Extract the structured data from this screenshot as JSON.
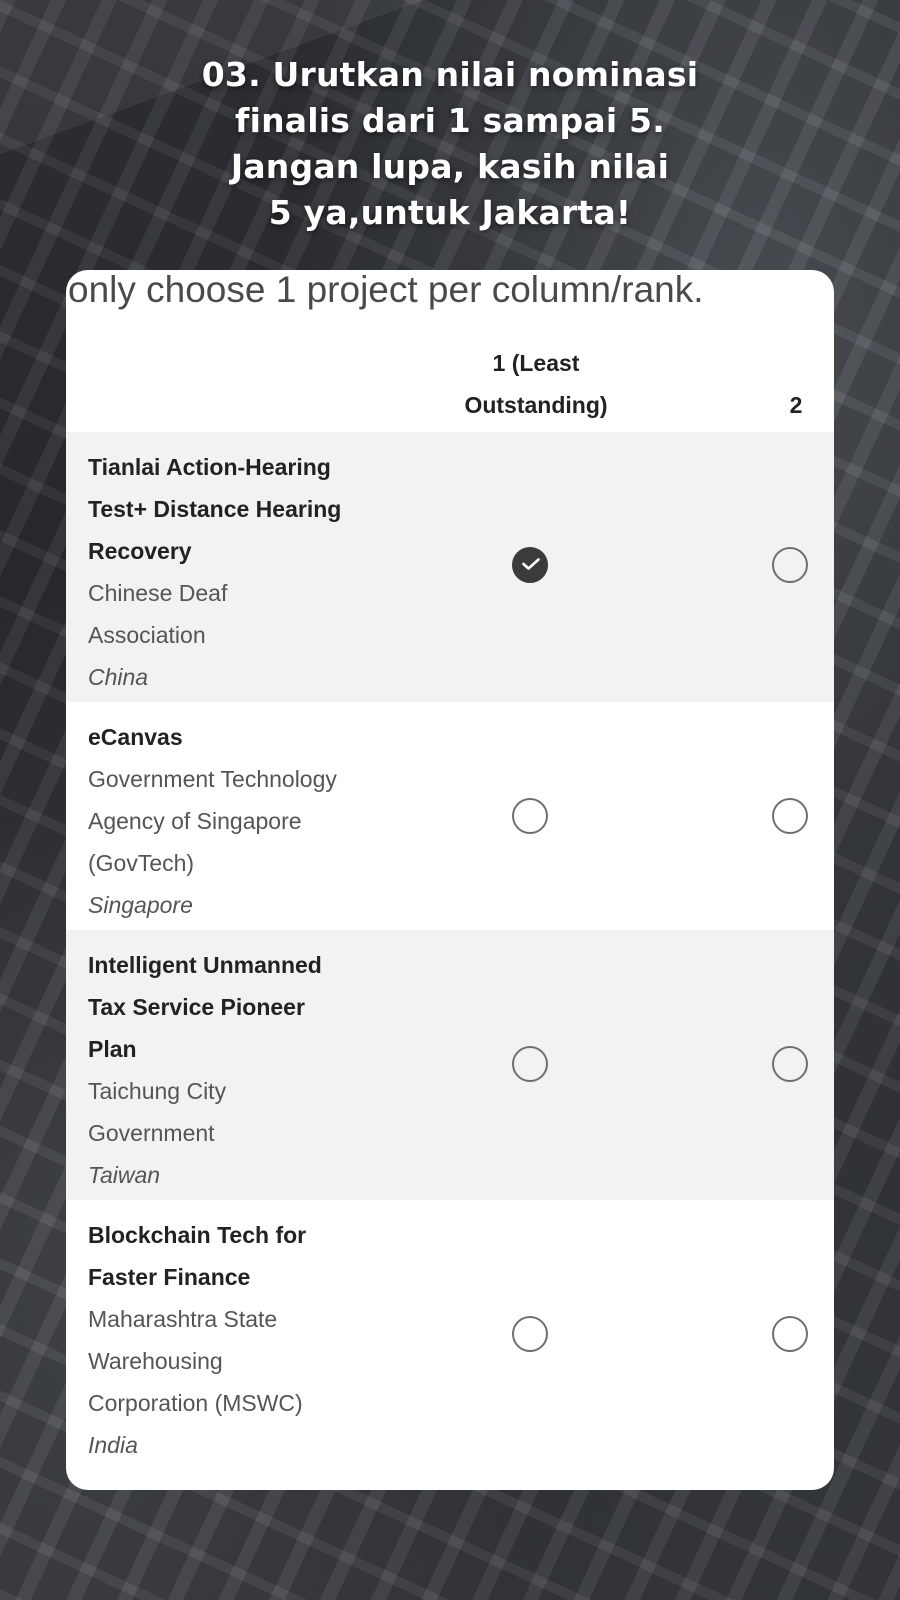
{
  "headline": {
    "line1": "03. Urutkan nilai nominasi",
    "line2": "finalis dari 1 sampai 5.",
    "line3": "Jangan lupa, kasih nilai",
    "line4": "5 ya,untuk Jakarta!"
  },
  "form": {
    "instruction": "only choose 1 project per column/rank.",
    "columns": [
      {
        "label_line1": "1 (Least",
        "label_line2": "Outstanding)"
      },
      {
        "label": "2"
      }
    ],
    "rows": [
      {
        "title_line1": "Tianlai Action-Hearing",
        "title_line2": "Test+ Distance Hearing",
        "title_line3": "Recovery",
        "org_line1": "Chinese Deaf",
        "org_line2": "Association",
        "country": "China",
        "col1_selected": true,
        "col2_selected": false
      },
      {
        "title_line1": "eCanvas",
        "org_line1": "Government Technology",
        "org_line2": "Agency of Singapore",
        "org_line3": "(GovTech)",
        "country": "Singapore",
        "col1_selected": false,
        "col2_selected": false
      },
      {
        "title_line1": "Intelligent Unmanned",
        "title_line2": "Tax Service Pioneer",
        "title_line3": "Plan",
        "org_line1": "Taichung City",
        "org_line2": "Government",
        "country": "Taiwan",
        "col1_selected": false,
        "col2_selected": false
      },
      {
        "title_line1": "Blockchain Tech for",
        "title_line2": "Faster Finance",
        "org_line1": "Maharashtra State",
        "org_line2": "Warehousing",
        "org_line3": "Corporation (MSWC)",
        "country": "India",
        "col1_selected": false,
        "col2_selected": false
      }
    ]
  },
  "icons": {
    "checked_radio": "check-circle-icon"
  }
}
